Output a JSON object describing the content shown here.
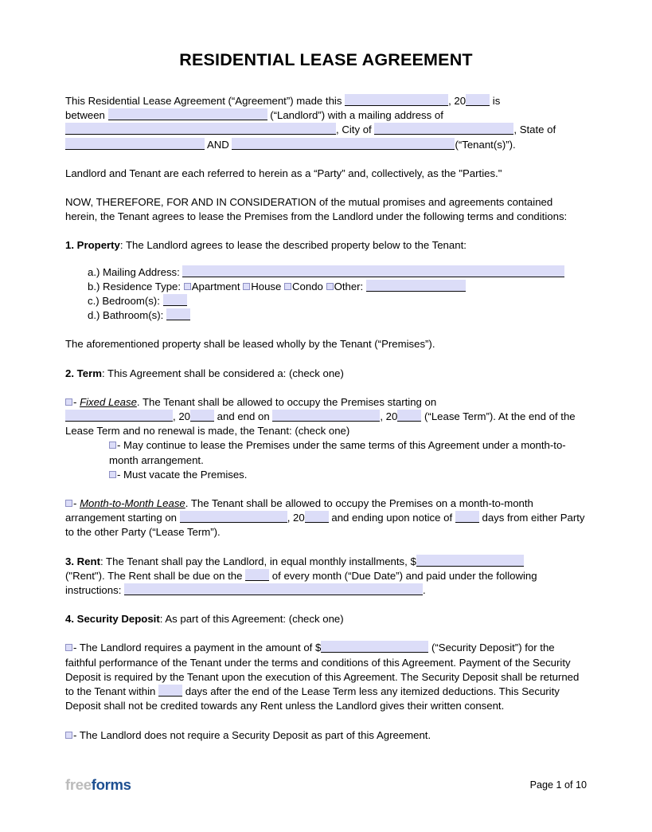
{
  "document": {
    "title": "RESIDENTIAL LEASE AGREEMENT"
  },
  "intro": {
    "line1_a": "This Residential Lease Agreement (“Agreement”) made this",
    "line1_b": ", 20",
    "line1_c": "is",
    "line2_a": "between",
    "line2_b": "(“Landlord”) with a mailing address of",
    "line3_b": ", City of",
    "line3_c": ", State of",
    "line4_b": "AND",
    "line4_c": "(“Tenant(s)”).",
    "parties": "Landlord and Tenant are each referred to herein as a “Party” and, collectively, as the \"Parties.\"",
    "consideration": "NOW, THEREFORE, FOR AND IN CONSIDERATION of the mutual promises and agreements contained herein, the Tenant agrees to lease the Premises from the Landlord under the following terms and conditions:"
  },
  "section1": {
    "number": "1. Property",
    "heading_rest": ": The Landlord agrees to lease the described property below to the Tenant:",
    "item_a_label": "a.)  Mailing Address:",
    "item_b_label": "b.)  Residence Type:",
    "residence_options": [
      "Apartment",
      "House",
      "Condo",
      "Other:"
    ],
    "item_c_label": "c.)  Bedroom(s):",
    "item_d_label": "d.)  Bathroom(s):",
    "premises_note": "The aforementioned property shall be leased wholly by the Tenant (“Premises”)."
  },
  "section2": {
    "number": "2. Term",
    "heading_rest": ": This Agreement shall be considered a: (check one)",
    "fixed_label": "Fixed Lease",
    "fixed_a": "- ",
    "fixed_b": ". The Tenant shall be allowed to occupy the Premises starting on",
    "fixed_c": ", 20",
    "fixed_d": "and end on",
    "fixed_e": ", 20",
    "fixed_f": "(“Lease Term”). At the end of the Lease Term and no renewal is made, the Tenant: (check one)",
    "sub_option_1": "- May continue to lease the Premises under the same terms of this Agreement under a month-to-month arrangement.",
    "sub_option_2": "- Must vacate the Premises.",
    "mtm_label": "Month-to-Month Lease",
    "mtm_a": "- ",
    "mtm_b": ". The Tenant shall be allowed to occupy the Premises on a month-to-month arrangement starting on",
    "mtm_c": ", 20",
    "mtm_d": "and ending upon notice of",
    "mtm_e": "days from either Party to the other Party (“Lease Term”)."
  },
  "section3": {
    "number": "3. Rent",
    "text_a": ": The Tenant shall pay the Landlord, in equal monthly installments, $",
    "text_b": "(\"Rent\"). The Rent shall be due on the",
    "text_c": "of every month (“Due Date”) and paid under the following instructions:",
    "text_d": "."
  },
  "section4": {
    "number": "4. Security Deposit",
    "heading_rest": ": As part of this Agreement: (check one)",
    "option1_a": "- The Landlord requires a payment in the amount of $",
    "option1_b": "(“Security Deposit”) for the faithful performance of the Tenant under the terms and conditions of this Agreement. Payment of the Security Deposit is required by the Tenant upon the execution of this Agreement. The Security Deposit shall be returned to the Tenant within",
    "option1_c": "days after the end of the Lease Term less any itemized deductions. This Security Deposit shall not be credited towards any Rent unless the Landlord gives their written consent.",
    "option2": "- The Landlord does not require a Security Deposit as part of this Agreement."
  },
  "footer": {
    "logo_first": "free",
    "logo_second": "forms",
    "page_number": "Page 1 of 10"
  },
  "colors": {
    "field_fill": "#dcddf8",
    "checkbox_border": "#8e90c4",
    "logo_gray": "#bcbcbc",
    "logo_blue": "#1d4f91"
  }
}
